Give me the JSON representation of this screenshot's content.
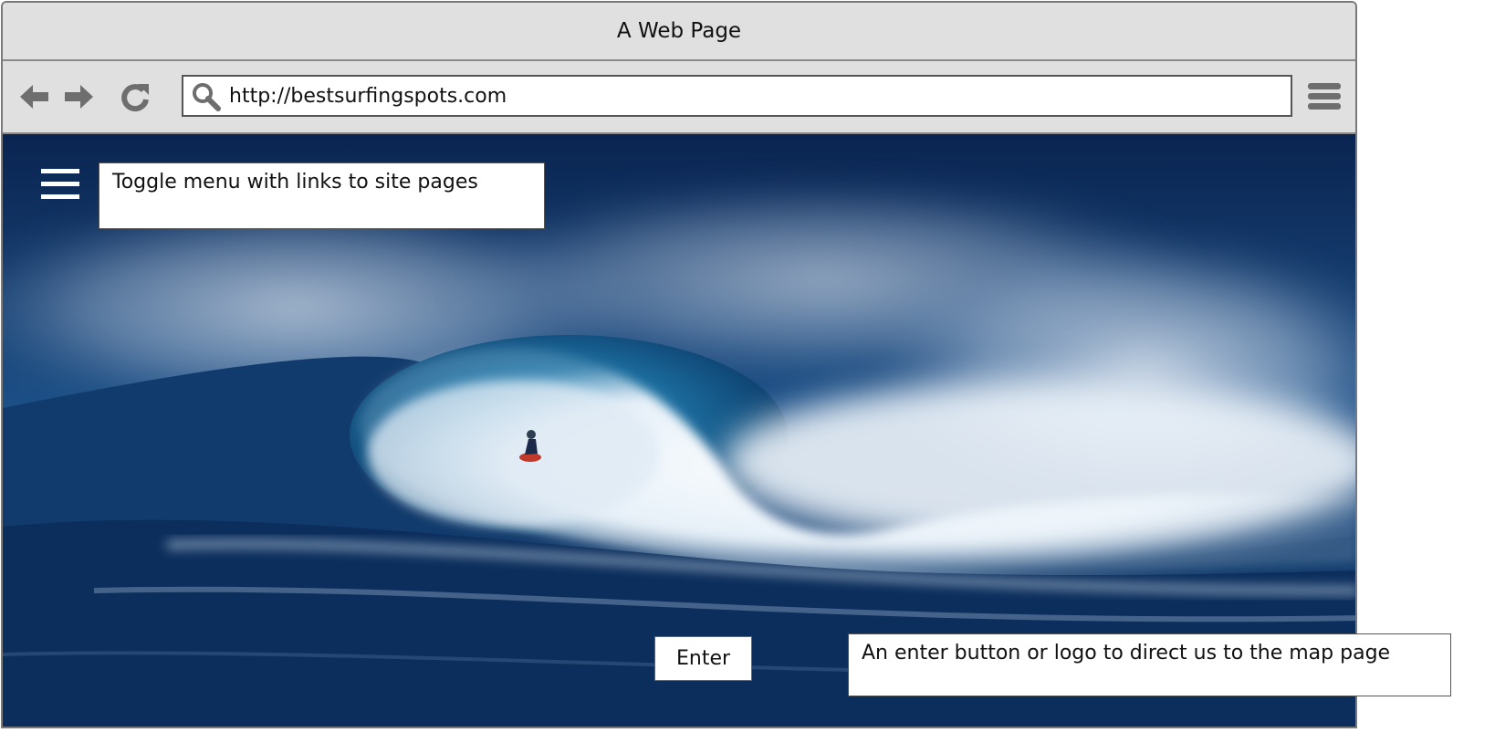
{
  "window": {
    "title": "A Web Page"
  },
  "toolbar": {
    "back_icon": "arrow-left-icon",
    "forward_icon": "arrow-right-icon",
    "reload_icon": "reload-icon",
    "search_icon": "search-icon",
    "url": "http://bestsurfingspots.com",
    "menu_icon": "hamburger-menu-icon"
  },
  "page": {
    "hero_image": "Surfer riding a large breaking ocean wave",
    "menu_icon": "hamburger-menu-icon",
    "menu_note": "Toggle menu with links to site pages",
    "enter_label": "Enter",
    "enter_note": "An enter button or logo to direct us to the map page"
  },
  "colors": {
    "chrome": "#e0e0e0",
    "chrome_border": "#8a8a8a",
    "icon_gray": "#6e6e6e",
    "ocean_dark": "#0b2a54",
    "wave_foam": "#e8f1f8"
  }
}
